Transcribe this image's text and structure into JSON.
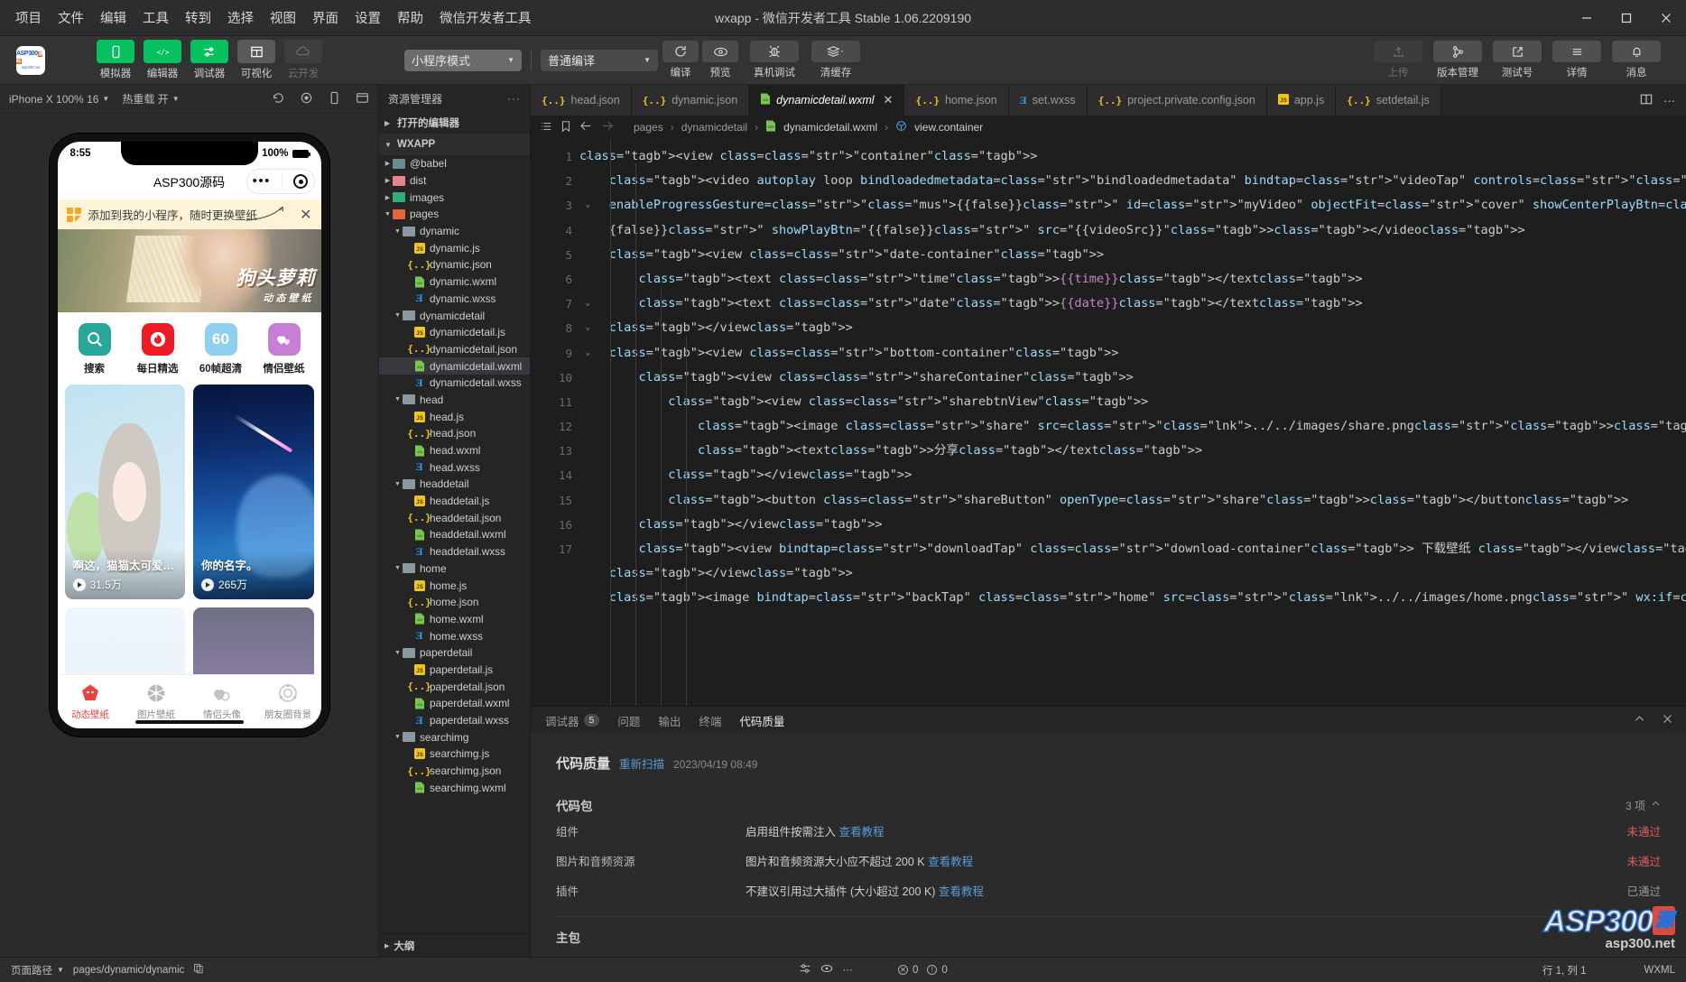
{
  "window": {
    "title": "wxapp - 微信开发者工具 Stable 1.06.2209190",
    "minimize": "─",
    "maximize": "❐",
    "close": "✕"
  },
  "menu": [
    "项目",
    "文件",
    "编辑",
    "工具",
    "转到",
    "选择",
    "视图",
    "界面",
    "设置",
    "帮助",
    "微信开发者工具"
  ],
  "toolbar": {
    "logo_line1": "ASP300",
    "logo_badge": "源码",
    "logo_line2": "asp300.net",
    "modes": [
      {
        "name": "simulator",
        "label": "模拟器",
        "icon": "phone-icon",
        "style": "green"
      },
      {
        "name": "editor",
        "label": "编辑器",
        "icon": "code-icon",
        "style": "green"
      },
      {
        "name": "debugger",
        "label": "调试器",
        "icon": "sliders-icon",
        "style": "green"
      },
      {
        "name": "visualize",
        "label": "可视化",
        "icon": "layout-icon",
        "style": "grey"
      },
      {
        "name": "clouddev",
        "label": "云开发",
        "icon": "cloud-icon",
        "style": "dim"
      }
    ],
    "mode_select": "小程序模式",
    "compile_select": "普通编译",
    "actions": [
      {
        "name": "compile",
        "label": "编译",
        "icon": "refresh-icon"
      },
      {
        "name": "preview",
        "label": "预览",
        "icon": "eye-icon"
      },
      {
        "name": "real-debug",
        "label": "真机调试",
        "icon": "bug-icon"
      },
      {
        "name": "clear-cache",
        "label": "清缓存",
        "icon": "layers-icon"
      }
    ],
    "right_actions": [
      {
        "name": "upload",
        "label": "上传",
        "icon": "upload-icon",
        "dim": true
      },
      {
        "name": "version",
        "label": "版本管理",
        "icon": "branch-icon",
        "dim": false
      },
      {
        "name": "test-id",
        "label": "测试号",
        "icon": "external-link-icon",
        "dim": false
      },
      {
        "name": "details",
        "label": "详情",
        "icon": "menu-icon",
        "dim": false
      },
      {
        "name": "messages",
        "label": "消息",
        "icon": "bell-icon",
        "dim": false
      }
    ]
  },
  "simulator": {
    "device": "iPhone X 100% 16",
    "hot_reload": "热重载 开",
    "icons": [
      "rotate-icon",
      "record-icon",
      "device-icon",
      "fullscreen-icon"
    ],
    "phone": {
      "time": "8:55",
      "battery_text": "100%",
      "nav_title": "ASP300源码",
      "add_banner": "添加到我的小程序，随时更换壁纸",
      "banner_title": "狗头萝莉",
      "banner_sub": "动态壁纸",
      "quicknav": [
        {
          "label": "搜索",
          "icon": "search-icon",
          "color": "#2aa79b"
        },
        {
          "label": "每日精选",
          "icon": "flame-icon",
          "color": "#ee1b24"
        },
        {
          "label": "60帧超清",
          "icon": "60-text",
          "color": "#8fd0ee"
        },
        {
          "label": "情侣壁纸",
          "icon": "hearts-icon",
          "color": "#c77fd6"
        }
      ],
      "cards": [
        {
          "title": "啊这，猫猫太可爱了叭修...",
          "plays": "31.5万"
        },
        {
          "title": "你的名字。",
          "plays": "265万"
        },
        {
          "title": "",
          "plays": ""
        },
        {
          "title": "",
          "plays": ""
        }
      ],
      "tabbar": [
        {
          "label": "动态壁纸",
          "icon": "video-icon",
          "active": true
        },
        {
          "label": "图片壁纸",
          "icon": "image-icon",
          "active": false
        },
        {
          "label": "情侣头像",
          "icon": "couple-icon",
          "active": false
        },
        {
          "label": "朋友圈背景",
          "icon": "friends-icon",
          "active": false
        }
      ]
    }
  },
  "explorer": {
    "title": "资源管理器",
    "more": "···",
    "open_editors": "打开的编辑器",
    "project": "WXAPP",
    "outline": "大纲",
    "tree": [
      {
        "indent": 1,
        "type": "folder",
        "name": "@babel",
        "open": false,
        "color": "#6a8a96"
      },
      {
        "indent": 1,
        "type": "folder",
        "name": "dist",
        "open": false,
        "color": "#e8828c"
      },
      {
        "indent": 1,
        "type": "folder",
        "name": "images",
        "open": false,
        "color": "#2fae7a"
      },
      {
        "indent": 1,
        "type": "folder",
        "name": "pages",
        "open": true,
        "color": "#e8653c"
      },
      {
        "indent": 2,
        "type": "folder",
        "name": "dynamic",
        "open": true,
        "color": "#8a9aa3"
      },
      {
        "indent": 3,
        "type": "js",
        "name": "dynamic.js"
      },
      {
        "indent": 3,
        "type": "json",
        "name": "dynamic.json"
      },
      {
        "indent": 3,
        "type": "wxml",
        "name": "dynamic.wxml"
      },
      {
        "indent": 3,
        "type": "wxss",
        "name": "dynamic.wxss"
      },
      {
        "indent": 2,
        "type": "folder",
        "name": "dynamicdetail",
        "open": true,
        "color": "#8a9aa3"
      },
      {
        "indent": 3,
        "type": "js",
        "name": "dynamicdetail.js"
      },
      {
        "indent": 3,
        "type": "json",
        "name": "dynamicdetail.json"
      },
      {
        "indent": 3,
        "type": "wxml",
        "name": "dynamicdetail.wxml",
        "selected": true
      },
      {
        "indent": 3,
        "type": "wxss",
        "name": "dynamicdetail.wxss"
      },
      {
        "indent": 2,
        "type": "folder",
        "name": "head",
        "open": true,
        "color": "#8a9aa3"
      },
      {
        "indent": 3,
        "type": "js",
        "name": "head.js"
      },
      {
        "indent": 3,
        "type": "json",
        "name": "head.json"
      },
      {
        "indent": 3,
        "type": "wxml",
        "name": "head.wxml"
      },
      {
        "indent": 3,
        "type": "wxss",
        "name": "head.wxss"
      },
      {
        "indent": 2,
        "type": "folder",
        "name": "headdetail",
        "open": true,
        "color": "#8a9aa3"
      },
      {
        "indent": 3,
        "type": "js",
        "name": "headdetail.js"
      },
      {
        "indent": 3,
        "type": "json",
        "name": "headdetail.json"
      },
      {
        "indent": 3,
        "type": "wxml",
        "name": "headdetail.wxml"
      },
      {
        "indent": 3,
        "type": "wxss",
        "name": "headdetail.wxss"
      },
      {
        "indent": 2,
        "type": "folder",
        "name": "home",
        "open": true,
        "color": "#8a9aa3"
      },
      {
        "indent": 3,
        "type": "js",
        "name": "home.js"
      },
      {
        "indent": 3,
        "type": "json",
        "name": "home.json"
      },
      {
        "indent": 3,
        "type": "wxml",
        "name": "home.wxml"
      },
      {
        "indent": 3,
        "type": "wxss",
        "name": "home.wxss"
      },
      {
        "indent": 2,
        "type": "folder",
        "name": "paperdetail",
        "open": true,
        "color": "#8a9aa3"
      },
      {
        "indent": 3,
        "type": "js",
        "name": "paperdetail.js"
      },
      {
        "indent": 3,
        "type": "json",
        "name": "paperdetail.json"
      },
      {
        "indent": 3,
        "type": "wxml",
        "name": "paperdetail.wxml"
      },
      {
        "indent": 3,
        "type": "wxss",
        "name": "paperdetail.wxss"
      },
      {
        "indent": 2,
        "type": "folder",
        "name": "searchimg",
        "open": true,
        "color": "#8a9aa3"
      },
      {
        "indent": 3,
        "type": "js",
        "name": "searchimg.js"
      },
      {
        "indent": 3,
        "type": "json",
        "name": "searchimg.json"
      },
      {
        "indent": 3,
        "type": "wxml",
        "name": "searchimg.wxml"
      }
    ]
  },
  "editor": {
    "tabs": [
      {
        "label": "head.json",
        "type": "json",
        "active": false
      },
      {
        "label": "dynamic.json",
        "type": "json",
        "active": false
      },
      {
        "label": "dynamicdetail.wxml",
        "type": "wxml",
        "active": true
      },
      {
        "label": "home.json",
        "type": "json",
        "active": false
      },
      {
        "label": "set.wxss",
        "type": "wxss",
        "active": false
      },
      {
        "label": "project.private.config.json",
        "type": "json",
        "active": false
      },
      {
        "label": "app.js",
        "type": "js",
        "active": false
      },
      {
        "label": "setdetail.js",
        "type": "json",
        "active": false
      }
    ],
    "tab_actions": [
      "split-editor-icon",
      "more-icon"
    ],
    "breadcrumb": [
      "pages",
      "dynamicdetail",
      "dynamicdetail.wxml",
      "view.container"
    ],
    "breadcrumb_icons": [
      "list-icon",
      "bookmark-icon",
      "arrow-left-icon",
      "arrow-right-icon"
    ],
    "line_numbers": [
      "1",
      "2",
      "3",
      "4",
      "5",
      "6",
      "7",
      "8",
      "9",
      "10",
      "11",
      "12",
      "13",
      "14",
      "15",
      "16",
      "17"
    ],
    "code_lines": [
      "<view class=\"container\">",
      "    <video autoplay loop bindloadedmetadata=\"bindloadedmetadata\" bindtap=\"videoTap\" controls=\"{{false}}\" enableProgressGesture=\"{{false}}\" id=\"myVideo\" objectFit=\"cover\" showCenterPlayBtn=\"{{false}}\" showFullscreenBtn=\"{{false}}\" showPlayBtn=\"{{false}}\" src=\"{{videoSrc}}\"></video>",
      "    <view class=\"date-container\">",
      "        <text class=\"time\">{{time}}</text>",
      "        <text class=\"date\">{{date}}</text>",
      "    </view>",
      "    <view class=\"bottom-container\">",
      "        <view class=\"shareContainer\">",
      "            <view class=\"sharebtnView\">",
      "                <image class=\"share\" src=\"../../images/share.png\"></image>",
      "                <text>分享</text>",
      "            </view>",
      "            <button class=\"shareButton\" openType=\"share\"></button>",
      "        </view>",
      "        <view bindtap=\"downloadTap\" class=\"download-container\"> 下载壁纸 </view>",
      "    </view>",
      "    <image bindtap=\"backTap\" class=\"home\" src=\"../../images/home.png\" wx:if=\"{{isShare}}\"></image>"
    ]
  },
  "panel": {
    "tabs": [
      {
        "label": "调试器",
        "badge": "5",
        "active": false
      },
      {
        "label": "问题",
        "badge": "",
        "active": false
      },
      {
        "label": "输出",
        "badge": "",
        "active": false
      },
      {
        "label": "终端",
        "badge": "",
        "active": false
      },
      {
        "label": "代码质量",
        "badge": "",
        "active": true
      }
    ],
    "collapse_icon": "chevron-up-icon",
    "close_icon": "close-icon",
    "quality": {
      "title": "代码质量",
      "rescan": "重新扫描",
      "timestamp": "2023/04/19 08:49",
      "section1_title": "代码包",
      "section1_count": "3 项",
      "rows": [
        {
          "name": "组件",
          "desc": "启用组件按需注入",
          "link": "查看教程",
          "status": "未通过",
          "pass": false
        },
        {
          "name": "图片和音频资源",
          "desc": "图片和音频资源大小应不超过 200 K",
          "link": "查看教程",
          "status": "未通过",
          "pass": false
        },
        {
          "name": "插件",
          "desc": "不建议引用过大插件 (大小超过 200 K)",
          "link": "查看教程",
          "status": "已通过",
          "pass": true
        }
      ],
      "section2_title": "主包"
    }
  },
  "status_bar": {
    "page_path_label": "页面路径",
    "page_path": "pages/dynamic/dynamic",
    "copy_icon": "copy-icon",
    "errors": "0",
    "warnings": "0",
    "cursor": "行 1, 列 1",
    "language": "WXML",
    "icons": [
      "settings-icon",
      "eye-icon",
      "more-icon"
    ]
  },
  "watermark": {
    "line1": "ASP300",
    "badge": "源",
    "line2": "asp300.net"
  }
}
